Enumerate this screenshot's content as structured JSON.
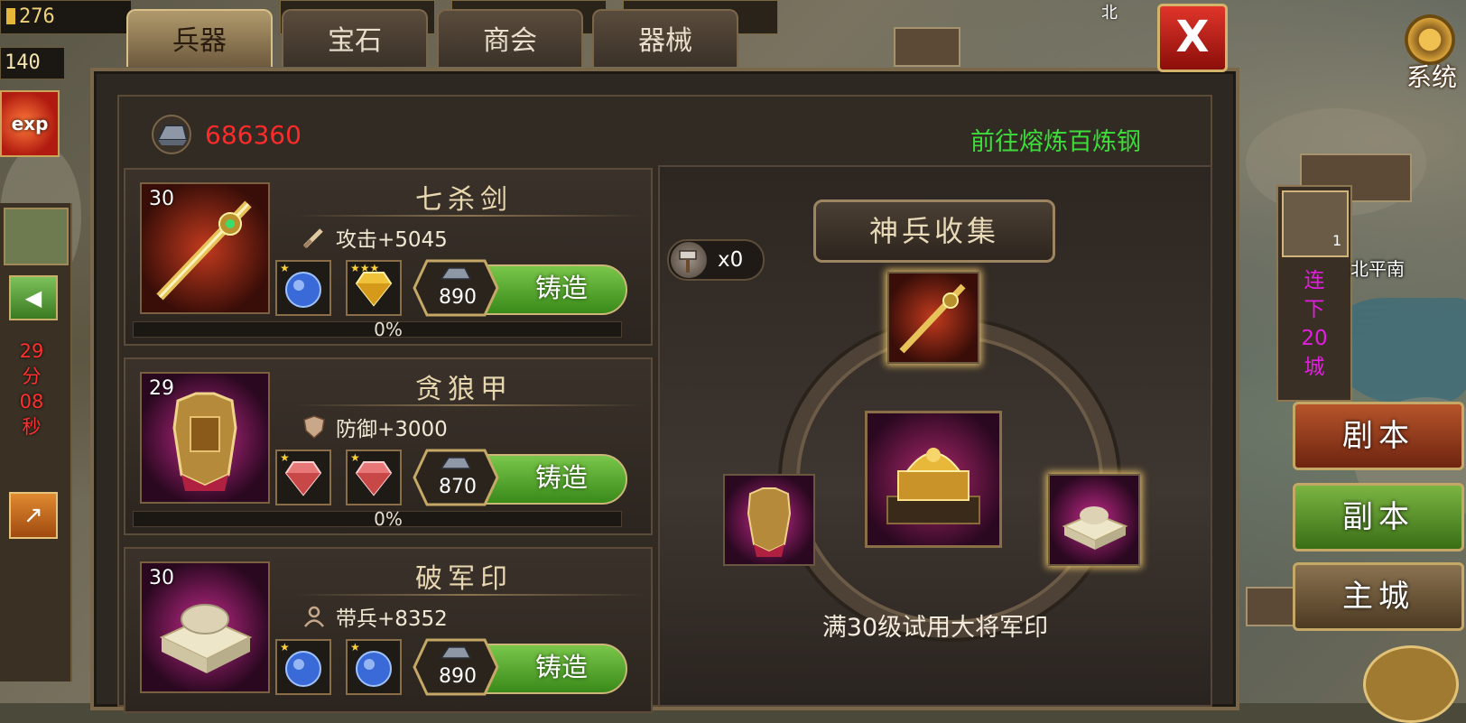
{
  "hud": {
    "gold": "276",
    "level": "140",
    "exp_badge": "exp"
  },
  "left": {
    "toggle_icon": "◀",
    "timer": [
      "29",
      "分",
      "08",
      "秒"
    ],
    "arrow_icon": "↗"
  },
  "tabs": [
    {
      "label": "兵器",
      "active": true
    },
    {
      "label": "宝石",
      "active": false
    },
    {
      "label": "商会",
      "active": false
    },
    {
      "label": "器械",
      "active": false
    }
  ],
  "close_icon": "X",
  "steel": {
    "amount": "686360",
    "smelt_link": "前往熔炼百炼钢"
  },
  "items": [
    {
      "name": "七杀剑",
      "level": "30",
      "stat": "攻击+5045",
      "stat_icon": "sword-icon",
      "gems": [
        {
          "type": "blue-gem",
          "stars": "★"
        },
        {
          "type": "gold-gem",
          "stars": "★★★"
        }
      ],
      "cost": "890",
      "forge_label": "铸造",
      "progress": "0%"
    },
    {
      "name": "贪狼甲",
      "level": "29",
      "stat": "防御+3000",
      "stat_icon": "shield-icon",
      "gems": [
        {
          "type": "red-gem",
          "stars": "★"
        },
        {
          "type": "red-gem",
          "stars": "★"
        }
      ],
      "cost": "870",
      "forge_label": "铸造",
      "progress": "0%"
    },
    {
      "name": "破军印",
      "level": "30",
      "stat": "带兵+8352",
      "stat_icon": "troops-icon",
      "gems": [
        {
          "type": "blue-gem",
          "stars": "★"
        },
        {
          "type": "blue-gem",
          "stars": "★"
        }
      ],
      "cost": "890",
      "forge_label": "铸造",
      "progress": ""
    }
  ],
  "collection": {
    "title": "神兵收集",
    "hammer_count": "x0",
    "hint": "满30级试用大将军印"
  },
  "right": {
    "quest_count": "1",
    "quest_text": [
      "连",
      "下",
      "20",
      "城"
    ],
    "place_label": "北平南",
    "map_label_top": "北",
    "system_label": "系统",
    "buttons": [
      "剧本",
      "副本",
      "主城"
    ]
  },
  "colors": {
    "steel_amount": "#ff2a2a",
    "smelt_link": "#3ddc3a",
    "quest_text": "#e21ee0",
    "timer": "#ff3030",
    "forge_button": "#5aa832"
  }
}
